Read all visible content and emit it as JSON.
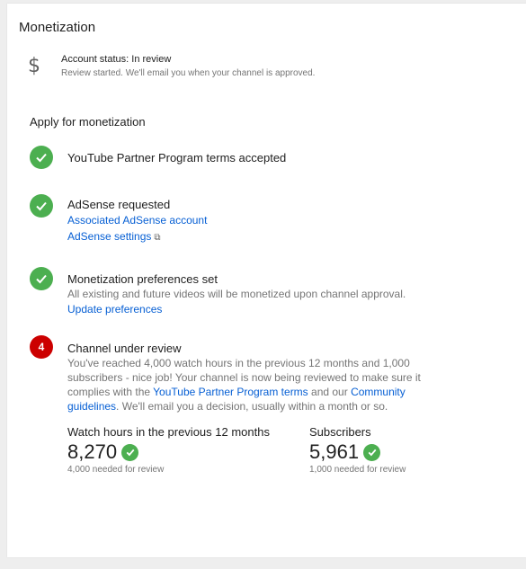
{
  "card": {
    "title": "Monetization",
    "account_status": "Account status: In review",
    "account_status_detail": "Review started. We'll email you when your channel is approved."
  },
  "apply": {
    "title": "Apply for monetization",
    "steps": [
      {
        "title": "YouTube Partner Program terms accepted",
        "state": "done"
      },
      {
        "title": "AdSense requested",
        "state": "done",
        "links": [
          "Associated AdSense account",
          "AdSense settings"
        ]
      },
      {
        "title": "Monetization preferences set",
        "state": "done",
        "description": "All existing and future videos will be monetized upon channel approval.",
        "links": [
          "Update preferences"
        ]
      },
      {
        "number": "4",
        "title": "Channel under review",
        "state": "in-review",
        "description_part1": "You've reached 4,000 watch hours in the previous 12 months and 1,000 subscribers - nice job! Your channel is now being reviewed to make sure it complies with the ",
        "link_terms": "YouTube Partner Program terms",
        "description_part2": " and our ",
        "link_guidelines": "Community guidelines",
        "description_part3": ". We'll email you a decision, usually within a month or so."
      }
    ]
  },
  "metrics": {
    "watch_hours": {
      "label": "Watch hours in the previous 12 months",
      "value": "8,270",
      "sub": "4,000 needed for review"
    },
    "subscribers": {
      "label": "Subscribers",
      "value": "5,961",
      "sub": "1,000 needed for review"
    }
  },
  "colors": {
    "success": "#4caf50",
    "step_number": "#cc0000",
    "link": "#065fd4"
  },
  "icons": [
    "dollar-icon",
    "check-icon",
    "external-link-icon"
  ]
}
